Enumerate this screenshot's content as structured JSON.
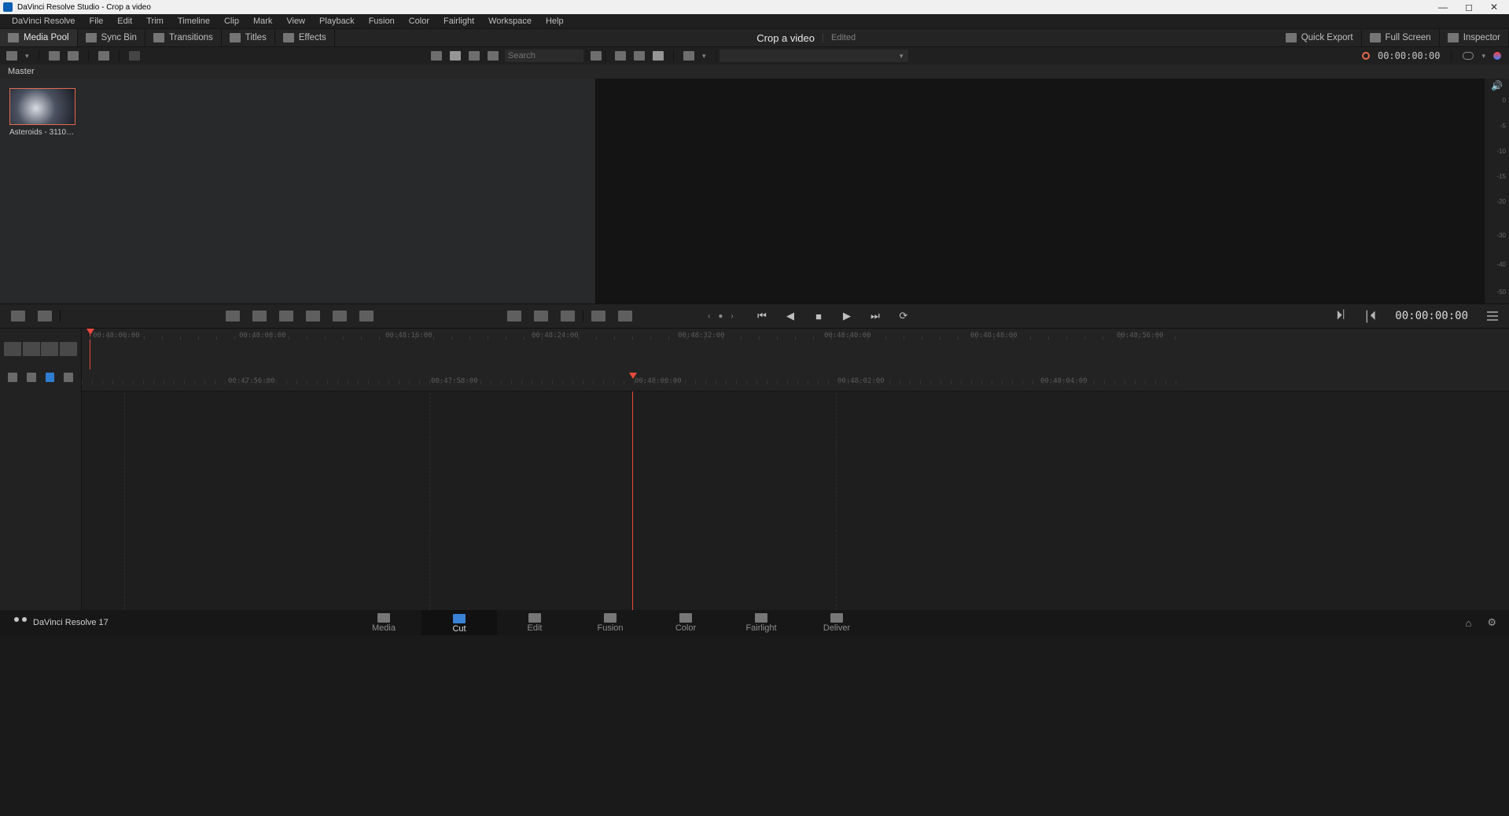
{
  "window": {
    "title": "DaVinci Resolve Studio - Crop a video"
  },
  "menu": [
    "DaVinci Resolve",
    "File",
    "Edit",
    "Trim",
    "Timeline",
    "Clip",
    "Mark",
    "View",
    "Playback",
    "Fusion",
    "Color",
    "Fairlight",
    "Workspace",
    "Help"
  ],
  "toolbar": {
    "items": [
      {
        "label": "Media Pool",
        "active": true
      },
      {
        "label": "Sync Bin",
        "active": false
      },
      {
        "label": "Transitions",
        "active": false
      },
      {
        "label": "Titles",
        "active": false
      },
      {
        "label": "Effects",
        "active": false
      }
    ],
    "project_name": "Crop a video",
    "project_status": "Edited",
    "right": [
      {
        "label": "Quick Export"
      },
      {
        "label": "Full Screen"
      },
      {
        "label": "Inspector"
      }
    ]
  },
  "strip": {
    "search_placeholder": "Search",
    "timecode_top": "00:00:00:00"
  },
  "pool": {
    "bin_label": "Master",
    "clips": [
      {
        "name": "Asteroids - 31105...."
      }
    ]
  },
  "audio_meter": {
    "marks": [
      "0",
      "-5",
      "-10",
      "-15",
      "-20",
      "-30",
      "-40",
      "-50"
    ]
  },
  "transport": {
    "timecode": "00:00:00:00"
  },
  "ruler_upper": {
    "labels": [
      "00:48:00:00",
      "00:48:08:00",
      "00:48:16:00",
      "00:48:24:00",
      "00:48:32:00",
      "00:48:40:00",
      "00:48:48:00",
      "00:48:56:00"
    ]
  },
  "ruler_lower": {
    "labels": [
      "00:47:56:00",
      "00:47:58:00",
      "00:48:00:00",
      "00:48:02:00",
      "00:48:04:00"
    ]
  },
  "pages": {
    "brand": "DaVinci Resolve 17",
    "tabs": [
      "Media",
      "Cut",
      "Edit",
      "Fusion",
      "Color",
      "Fairlight",
      "Deliver"
    ],
    "active": "Cut"
  }
}
